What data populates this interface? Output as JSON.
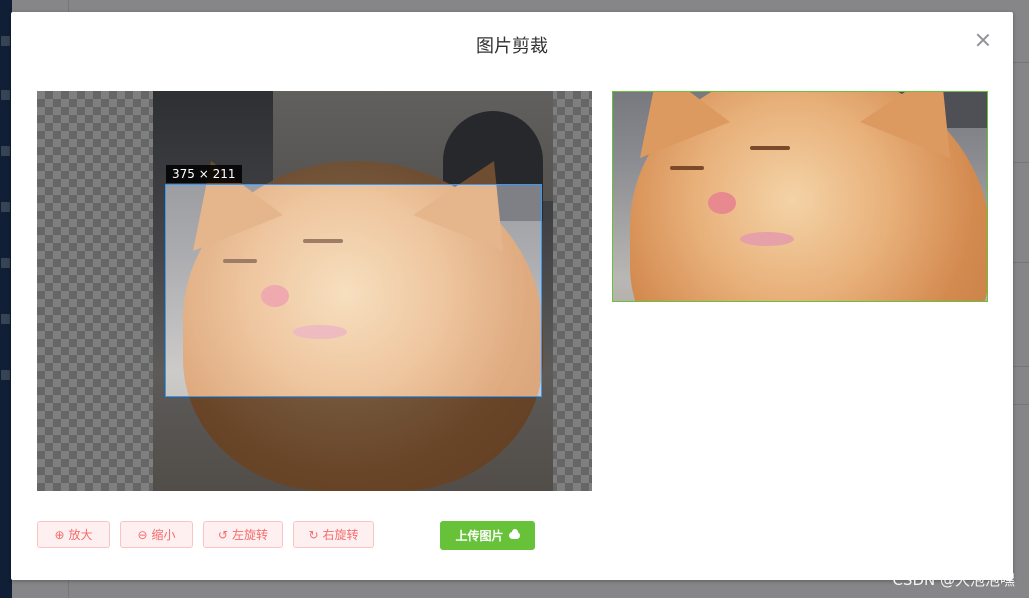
{
  "dialog": {
    "title": "图片剪裁",
    "close_icon": "close-icon"
  },
  "cropper": {
    "size_label": "375 × 211"
  },
  "toolbar": {
    "zoom_in_label": "放大",
    "zoom_in_icon": "zoom-in-icon",
    "zoom_out_label": "缩小",
    "zoom_out_icon": "zoom-out-icon",
    "rotate_left_label": "左旋转",
    "rotate_left_icon": "rotate-left-icon",
    "rotate_right_label": "右旋转",
    "rotate_right_icon": "rotate-right-icon",
    "upload_label": "上传图片",
    "upload_icon": "cloud-upload-icon"
  },
  "watermark": "CSDN @大泡泡嘿",
  "colors": {
    "upload_button": "#67c23a",
    "danger_plain_bg": "#fef0f0",
    "danger_plain_text": "#f56c6c",
    "preview_border": "#67c23a",
    "crop_outline": "#3399ff"
  }
}
